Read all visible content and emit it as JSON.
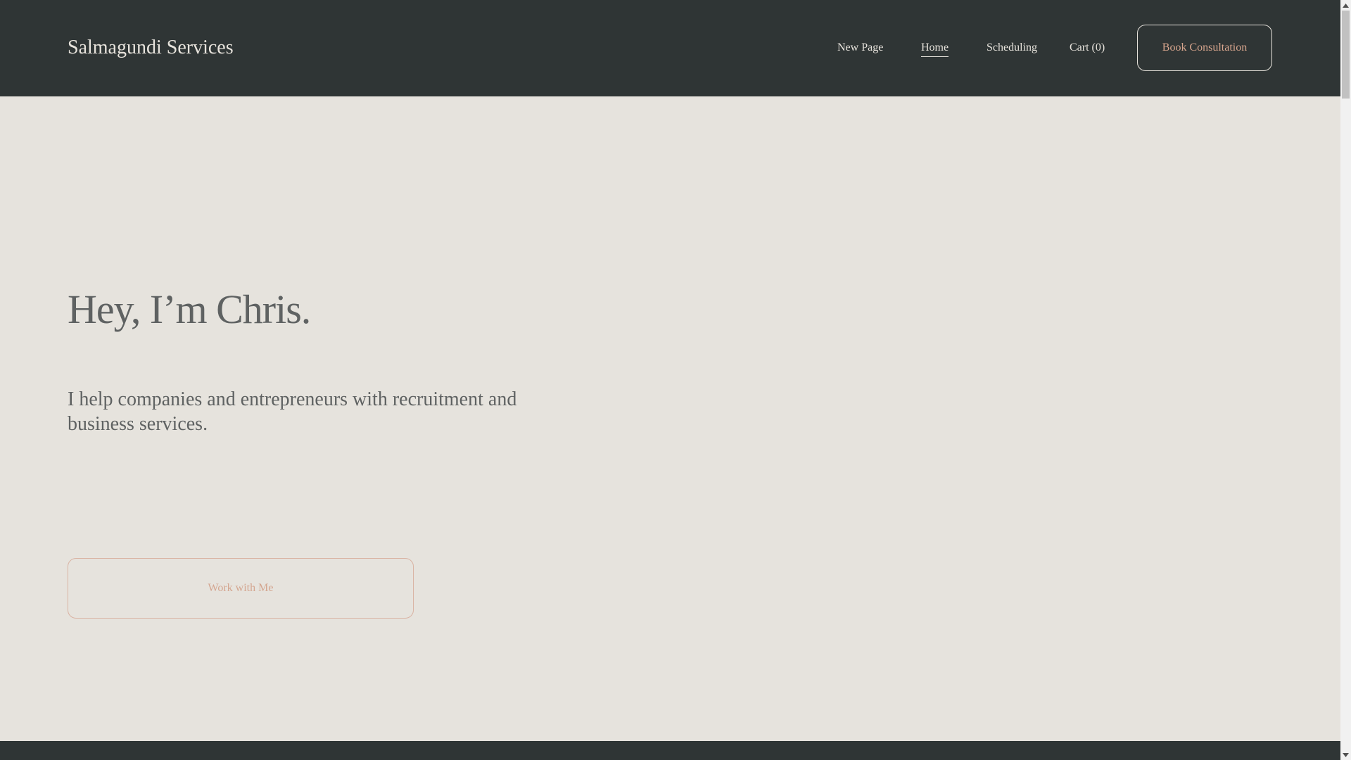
{
  "header": {
    "site_title": "Salmagundi Services",
    "nav": [
      {
        "label": "New Page"
      },
      {
        "label": "Home",
        "active": true
      },
      {
        "label": "Scheduling"
      },
      {
        "label": "Cart (0)"
      }
    ],
    "cta_label": "Book Consultation"
  },
  "hero": {
    "heading": "Hey, I’m Chris.",
    "subheading": "I help companies and entrepreneurs with recruitment and business services.",
    "button_label": "Work with Me"
  },
  "colors": {
    "header_bg": "#2f3535",
    "page_bg": "#e6e3dd",
    "accent": "#d4a690",
    "text": "#5f6262"
  },
  "icons": {
    "scroll_up": "scroll-up-arrow-icon",
    "scroll_down": "scroll-down-arrow-icon"
  }
}
